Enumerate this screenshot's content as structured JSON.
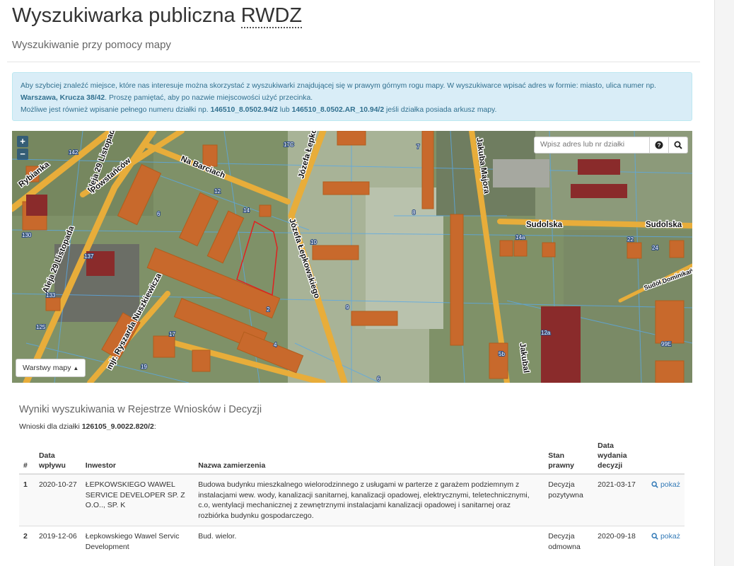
{
  "header": {
    "title_prefix": "Wyszukiwarka publiczna",
    "title_abbr": "RWDZ",
    "subtitle": "Wyszukiwanie przy pomocy mapy"
  },
  "info": {
    "line1_a": "Aby szybciej znaleźć miejsce, które nas interesuje można skorzystać z wyszukiwarki znajdującej się w prawym górnym rogu mapy. W wyszukiwarce wpisać adres w formie: miasto, ulica numer np.",
    "line1_example": "Warszawa, Krucza 38/42",
    "line1_b": ". Proszę pamiętać, aby po nazwie miejscowości użyć przecinka.",
    "line2_a": "Możliwe jest również wpisanie pełnego numeru działki np.",
    "line2_ex1": "146510_8.0502.94/2",
    "line2_mid": "lub",
    "line2_ex2": "146510_8.0502.AR_10.94/2",
    "line2_b": "jeśli działka posiada arkusz mapy."
  },
  "map": {
    "zoom_in": "+",
    "zoom_out": "−",
    "search_placeholder": "Wpisz adres lub nr działki",
    "help_icon": "question-circle-icon",
    "search_icon": "search-icon",
    "layers_label": "Warstwy mapy",
    "layers_icon": "caret-up-icon",
    "street_labels": [
      "Rybianka",
      "Aleja 29 Listopada",
      "Powstańców",
      "Na Barciach",
      "Józefa Łepkowskiego",
      "Jakuba Majora",
      "Sudolska",
      "Sudolska",
      "mjr. Ryszarda Nuszkiewicza",
      "Józefa Łepkowskiego",
      "Aleja 29 Listopada",
      "Jakubal",
      "Sudół Dominikański"
    ],
    "plot_numbers": [
      "142",
      "130",
      "137",
      "133",
      "125",
      "12",
      "10",
      "14",
      "6",
      "4",
      "2",
      "17",
      "19",
      "9",
      "7",
      "8",
      "14a",
      "22",
      "24",
      "12a",
      "5b",
      "99E",
      "17C",
      "6"
    ],
    "colors": {
      "building": "#c8692c",
      "road": "#e8ad3a",
      "parcel_line": "#5aa9e6",
      "selected_parcel": "#e02020"
    }
  },
  "results": {
    "title": "Wyniki wyszukiwania w Rejestrze Wniosków i Decyzji",
    "sub_prefix": "Wnioski dla działki",
    "parcel_id": "126105_9.0022.820/2",
    "sub_suffix": ":",
    "columns": [
      "#",
      "Data wpływu",
      "Inwestor",
      "Nazwa zamierzenia",
      "Stan prawny",
      "Data wydania decyzji",
      ""
    ],
    "rows": [
      {
        "num": "1",
        "date_in": "2020-10-27",
        "investor": "ŁEPKOWSKIEGO WAWEL SERVICE DEVELOPER SP. Z O.O.., SP. K",
        "name": "Budowa budynku mieszkalnego wielorodzinnego z usługami w parterze z garażem podziemnym z instalacjami wew. wody, kanalizacji sanitarnej, kanalizacji opadowej, elektrycznymi, teletechnicznymi, c.o, wentylacji mechanicznej z zewnętrznymi instalacjami kanalizacji opadowej i sanitarnej oraz rozbiórka budynku gospodarczego.",
        "status": "Decyzja pozytywna",
        "date_decision": "2021-03-17",
        "action": "pokaż"
      },
      {
        "num": "2",
        "date_in": "2019-12-06",
        "investor": "Łepkowskiego Wawel Servic Development",
        "name": "Bud. wielor.",
        "status": "Decyzja odmowna",
        "date_decision": "2020-09-18",
        "action": "pokaż"
      }
    ]
  }
}
